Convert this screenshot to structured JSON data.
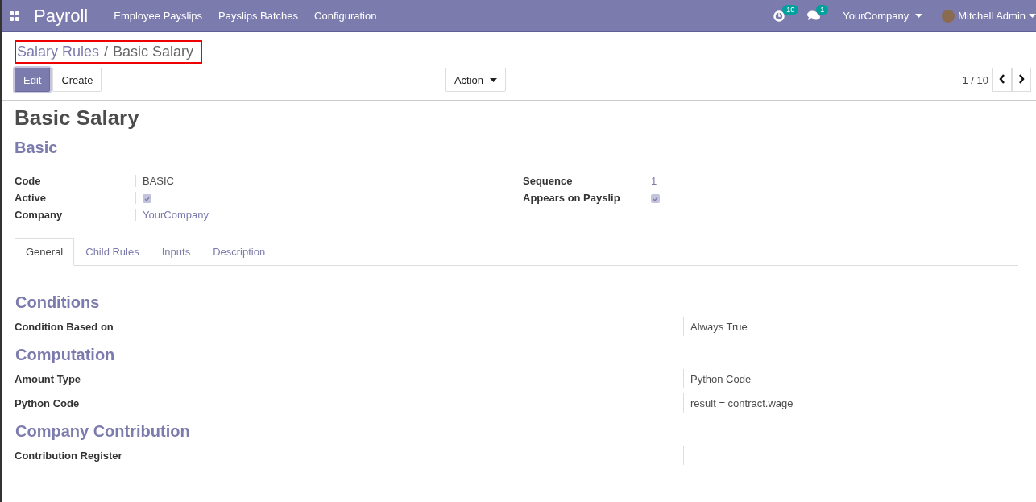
{
  "navbar": {
    "app_name": "Payroll",
    "menu": [
      "Employee Payslips",
      "Payslips Batches",
      "Configuration"
    ],
    "activity_badge": "10",
    "messages_badge": "1",
    "company": "YourCompany",
    "user": "Mitchell Admin"
  },
  "breadcrumb": {
    "highlighted": true,
    "separator": "/",
    "items": [
      {
        "label": "Salary Rules",
        "kind": "link"
      },
      {
        "label": "Basic Salary",
        "kind": "current"
      }
    ]
  },
  "buttons": [
    {
      "label": "Edit",
      "kind": "primary"
    },
    {
      "label": "Create",
      "kind": "secondary"
    }
  ],
  "action_menu": "Action",
  "pager": "1 / 10",
  "title": "Basic Salary",
  "category": "Basic",
  "fields_left": [
    {
      "label": "Code",
      "kind": "text",
      "value": "BASIC"
    },
    {
      "label": "Active",
      "kind": "checkbox",
      "checked": true
    },
    {
      "label": "Company",
      "kind": "link",
      "value": "YourCompany"
    }
  ],
  "fields_right": [
    {
      "label": "Sequence",
      "kind": "link",
      "value": "1"
    },
    {
      "label": "Appears on Payslip",
      "kind": "checkbox",
      "checked": true
    }
  ],
  "tabs": [
    {
      "label": "General",
      "selected": true
    },
    {
      "label": "Child Rules",
      "selected": false
    },
    {
      "label": "Inputs",
      "selected": false
    },
    {
      "label": "Description",
      "selected": false
    }
  ],
  "sections": [
    {
      "title": "Conditions",
      "fields": [
        {
          "label": "Condition Based on",
          "value": "Always True"
        }
      ]
    },
    {
      "title": "Computation",
      "fields": [
        {
          "label": "Amount Type",
          "value": "Python Code"
        },
        {
          "label": "Python Code",
          "value": "result = contract.wage"
        }
      ]
    },
    {
      "title": "Company Contribution",
      "fields": [
        {
          "label": "Contribution Register"
        }
      ]
    }
  ]
}
